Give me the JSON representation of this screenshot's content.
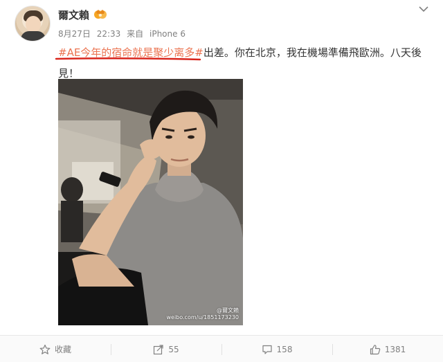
{
  "post": {
    "username": "爾文賴",
    "date": "8月27日",
    "time": "22:33",
    "source_prefix": "来自",
    "source_device": "iPhone 6",
    "hashtag": "#AE今年的宿命就是聚少离多#",
    "body_text": "出差。你在北京，我在機場準備飛歐洲。八天後見！",
    "watermark_name": "@爾文賴",
    "watermark_url": "weibo.com/u/1851173230"
  },
  "actions": {
    "favorite_label": "收藏",
    "repost_count": "55",
    "comment_count": "158",
    "like_count": "1381"
  },
  "colors": {
    "hashtag": "#eb7350",
    "underline": "#d9251c",
    "vip_badge": "#f6a623"
  },
  "icons": {
    "favorite": "star-icon",
    "repost": "share-icon",
    "comment": "comment-icon",
    "like": "thumbs-up-icon",
    "menu": "chevron-down-icon",
    "badge": "vip-badge-icon"
  }
}
